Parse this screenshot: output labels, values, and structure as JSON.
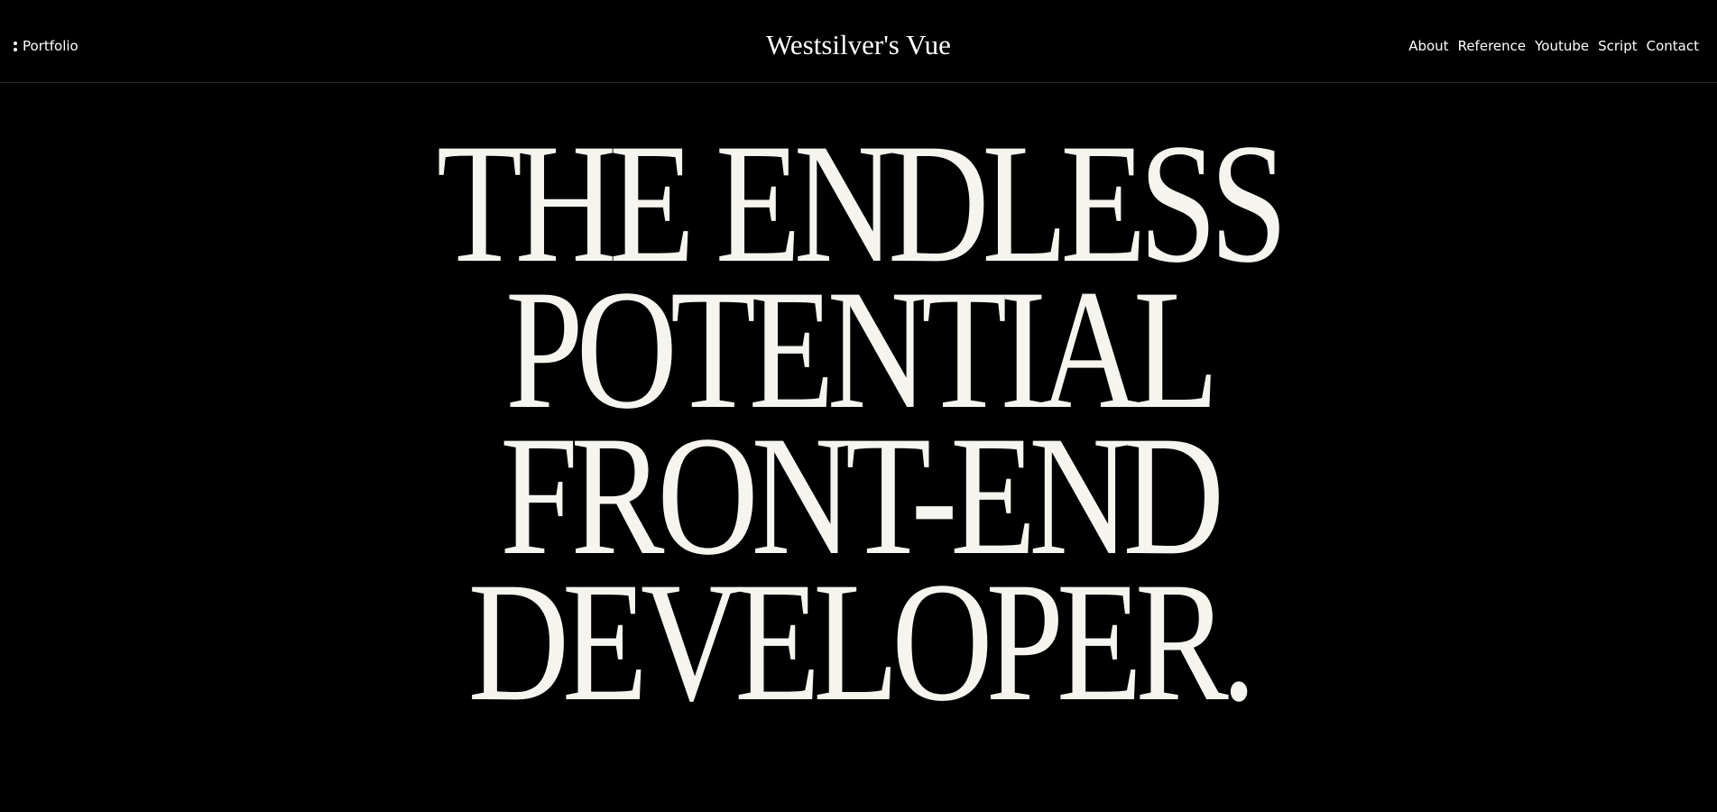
{
  "header": {
    "portfolio_label": "Portfolio",
    "site_title": "Westsilver's Vue",
    "nav": [
      {
        "label": "About"
      },
      {
        "label": "Reference"
      },
      {
        "label": "Youtube"
      },
      {
        "label": "Script"
      },
      {
        "label": "Contact"
      }
    ]
  },
  "hero": {
    "lines": [
      "THE ENDLESS",
      "POTENTIAL",
      "FRONT-END",
      "DEVELOPER."
    ]
  },
  "colors": {
    "background": "#000000",
    "text": "#ffffff",
    "hero_text": "#f6f4ee"
  }
}
